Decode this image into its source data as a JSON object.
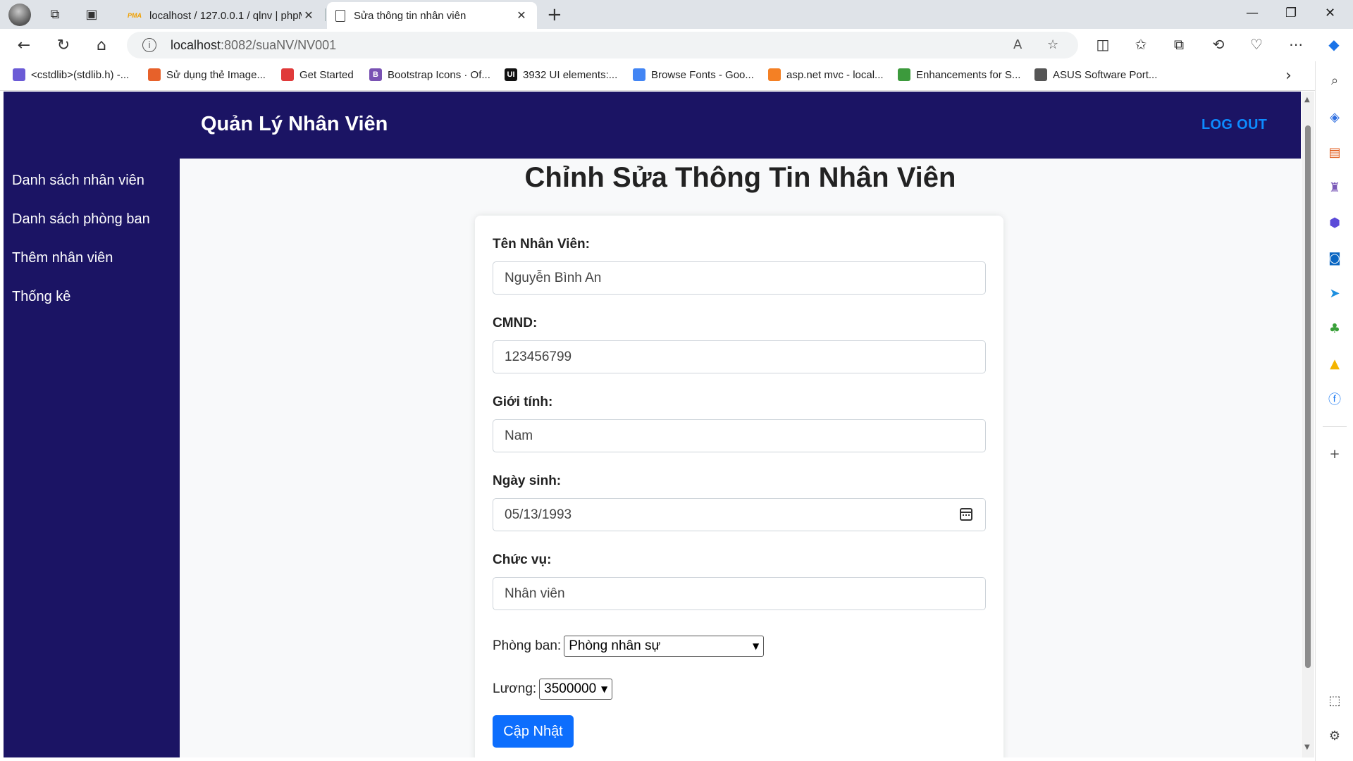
{
  "browser": {
    "tabs": [
      {
        "title": "localhost / 127.0.0.1 / qlnv | phpM",
        "favicon": "phpmyadmin-icon",
        "active": false
      },
      {
        "title": "Sửa thông tin nhân viên",
        "favicon": "page-icon",
        "active": true
      }
    ],
    "url_host": "localhost",
    "url_rest": ":8082/suaNV/NV001",
    "bookmarks": [
      {
        "label": "<cstdlib>(stdlib.h) -...",
        "color": "#6b5bd6"
      },
      {
        "label": "Sử dụng thẻ Image...",
        "color": "#e7612a"
      },
      {
        "label": "Get Started",
        "color": "#e03a3a"
      },
      {
        "label": "Bootstrap Icons · Of...",
        "color": "#7952b3"
      },
      {
        "label": "3932 UI elements:...",
        "color": "#111111"
      },
      {
        "label": "Browse Fonts - Goo...",
        "color": "#4285f4"
      },
      {
        "label": "asp.net mvc - local...",
        "color": "#f48024"
      },
      {
        "label": "Enhancements for S...",
        "color": "#3c9a3c"
      },
      {
        "label": "ASUS Software Port...",
        "color": "#555555"
      }
    ]
  },
  "app": {
    "title": "Quản Lý Nhân Viên",
    "logout": "LOG OUT",
    "header_color": "#1b1464",
    "menu": [
      {
        "label": "Danh sách nhân viên"
      },
      {
        "label": "Danh sách phòng ban"
      },
      {
        "label": "Thêm nhân viên"
      },
      {
        "label": "Thống kê"
      }
    ]
  },
  "form": {
    "heading": "Chỉnh Sửa Thông Tin Nhân Viên",
    "name_label": "Tên Nhân Viên:",
    "name_value": "Nguyễn Bình An",
    "cmnd_label": "CMND:",
    "cmnd_value": "123456799",
    "gender_label": "Giới tính:",
    "gender_value": "Nam",
    "dob_label": "Ngày sinh:",
    "dob_value": "05/13/1993",
    "position_label": "Chức vụ:",
    "position_value": "Nhân viên",
    "department_label": "Phòng ban:",
    "department_value": "Phòng nhân sự",
    "salary_label": "Lương:",
    "salary_value": "3500000",
    "submit_label": "Cập Nhật",
    "submit_color": "#0d6efd"
  }
}
